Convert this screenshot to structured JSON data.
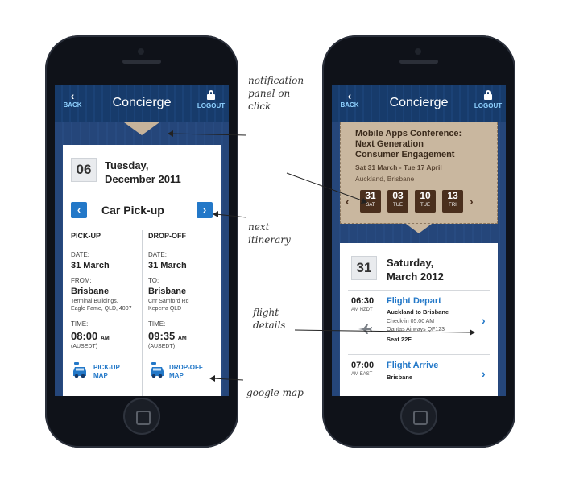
{
  "app": {
    "title": "Concierge",
    "back_label": "BACK",
    "logout_label": "LOGOUT",
    "back_glyph": "‹"
  },
  "left": {
    "date_num": "06",
    "date_line1": "Tuesday,",
    "date_line2": "December 2011",
    "section_title": "Car Pick-up",
    "prev_glyph": "‹",
    "next_glyph": "›",
    "pickup": {
      "head": "PICK-UP",
      "date_label": "DATE:",
      "date": "31 March",
      "from_label": "FROM:",
      "city": "Brisbane",
      "addr1": "Terminal Buildings,",
      "addr2": "Eagle Fame, QLD, 4007",
      "time_label": "TIME:",
      "time": "08:00",
      "ampm": "AM",
      "tz": "(AUSEDT)",
      "map1": "PICK-UP",
      "map2": "MAP"
    },
    "dropoff": {
      "head": "DROP-OFF",
      "date_label": "DATE:",
      "date": "31 March",
      "to_label": "TO:",
      "city": "Brisbane",
      "addr1": "Cnr Samford Rd",
      "addr2": "Keperra QLD",
      "time_label": "TIME:",
      "time": "09:35",
      "ampm": "AM",
      "tz": "(AUSEDT)",
      "map1": "DROP-OFF",
      "map2": "MAP"
    }
  },
  "right": {
    "event": {
      "title1": "Mobile Apps Conference:",
      "title2": "Next Generation",
      "title3": "Consumer Engagement",
      "dates": "Sat 31 March - Tue 17 April",
      "location": "Auckland, Brisbane",
      "days": [
        {
          "num": "31",
          "dow": "SAT"
        },
        {
          "num": "03",
          "dow": "TUE"
        },
        {
          "num": "10",
          "dow": "TUE"
        },
        {
          "num": "13",
          "dow": "FRI"
        }
      ],
      "prev_glyph": "‹",
      "next_glyph": "›"
    },
    "date_num": "31",
    "date_line1": "Saturday,",
    "date_line2": "March 2012",
    "flights": [
      {
        "time": "06:30",
        "tz": "AM NZDT",
        "title": "Flight Depart",
        "route": "Auckland to Brisbane",
        "meta1": "Check-in 05:00 AM",
        "meta2": "Qantas Airways QF123",
        "seat": "Seat 22F"
      },
      {
        "time": "07:00",
        "tz": "AM EAST",
        "title": "Flight Arrive",
        "route": "Brisbane"
      }
    ],
    "chev_glyph": "›"
  },
  "annotations": {
    "notification": [
      "notification",
      "panel on",
      "click"
    ],
    "next_itinerary": [
      "next",
      "itinerary"
    ],
    "flight_details": [
      "flight",
      "details"
    ],
    "google_map": "google map"
  },
  "colors": {
    "accent_blue": "#2378c8",
    "denim": "#25467a",
    "leather": "#c9b79f",
    "leather_dark": "#4a2f1d"
  },
  "icons": [
    "chevron-left-icon",
    "lock-icon",
    "car-icon",
    "key-icon",
    "airplane-icon",
    "chevron-right-icon"
  ]
}
